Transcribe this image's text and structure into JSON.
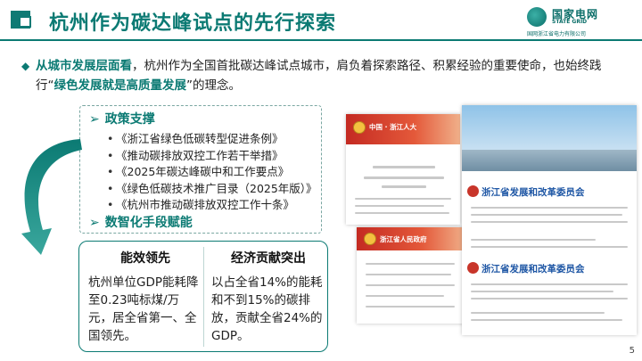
{
  "header": {
    "title": "杭州作为碳达峰试点的先行探索",
    "logo_cn": "国家电网",
    "logo_en": "STATE GRID",
    "logo_sub": "国网浙江省电力有限公司",
    "brand_color": "#0b7a73"
  },
  "intro": {
    "lead": "从城市发展层面看",
    "body1": "，杭州作为全国首批碳达峰试点城市，肩负着探索路径、积累经验的重要使命，也始终践行“",
    "highlight": "绿色发展就是高质量发展",
    "body2": "”的理念。"
  },
  "policy": {
    "heading": "政策支撑",
    "items": [
      "《浙江省绿色低碳转型促进条例》",
      "《推动碳排放双控工作若干举措》",
      "《2025年碳达峰碳中和工作要点》",
      "《绿色低碳技术推广目录（2025年版）》",
      "《杭州市推动碳排放双控工作十条》"
    ],
    "digital_heading": "数智化手段赋能"
  },
  "panel": {
    "col1": {
      "heading": "能效领先",
      "body": "杭州单位GDP能耗降至0.23吨标煤/万元，居全省第一、全国领先。"
    },
    "col2": {
      "heading": "经济贡献突出",
      "body": "以占全省14%的能耗和不到15%的碳排放，贡献全省24%的GDP。"
    }
  },
  "screenshots": {
    "s1_banner": "中国 · 浙江人大",
    "s2_banner": "浙江省人民政府",
    "s3_org1": "浙江省发展和改革委员会",
    "s3_org2": "浙江省发展和改革委员会"
  },
  "page_number": "5"
}
